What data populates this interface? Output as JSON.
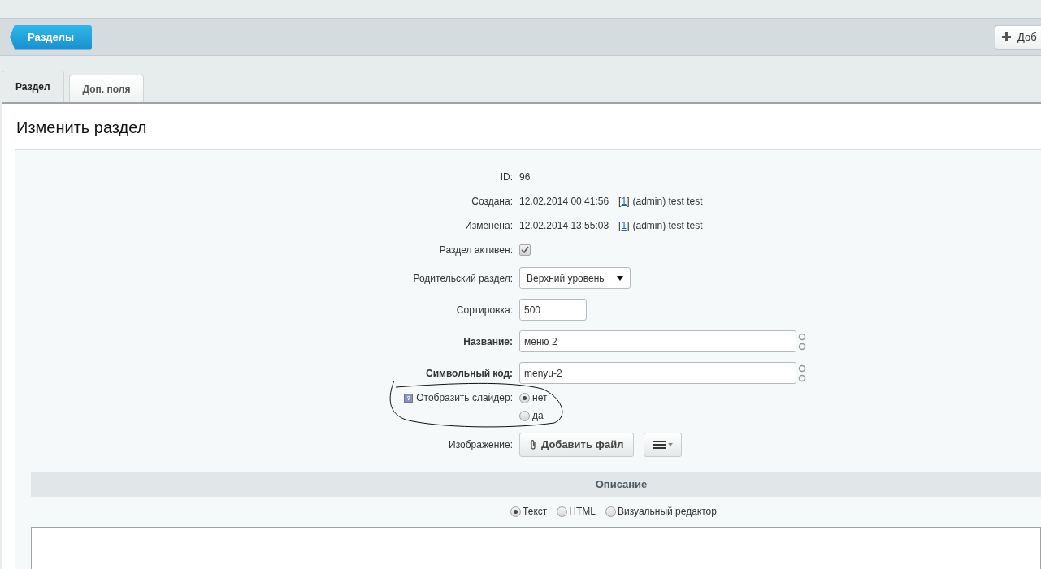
{
  "toolbar": {
    "back_button": "Разделы",
    "add_button": "Доб"
  },
  "tabs": [
    {
      "label": "Раздел",
      "selected": true
    },
    {
      "label": "Доп. поля",
      "selected": false
    }
  ],
  "heading": "Изменить раздел",
  "form": {
    "id": {
      "label": "ID:",
      "value": "96"
    },
    "created": {
      "label": "Создана:",
      "date": "12.02.2014 00:41:56",
      "bracket_left": "[",
      "user_link": "1",
      "bracket_right": "]",
      "user": "(admin) test test"
    },
    "modified": {
      "label": "Изменена:",
      "date": "12.02.2014 13:55:03",
      "bracket_left": "[",
      "user_link": "1",
      "bracket_right": "]",
      "user": "(admin) test test"
    },
    "active": {
      "label": "Раздел активен:",
      "checked": true
    },
    "parent": {
      "label": "Родительский раздел:",
      "value": "Верхний уровень"
    },
    "sort": {
      "label": "Сортировка:",
      "value": "500"
    },
    "name": {
      "label": "Название:",
      "value": "меню 2"
    },
    "code": {
      "label": "Символьный код:",
      "value": "menyu-2"
    },
    "slider": {
      "label": "Отобразить слайдер:",
      "help": "?",
      "options": [
        {
          "label": "нет",
          "selected": true
        },
        {
          "label": "да",
          "selected": false
        }
      ]
    },
    "image": {
      "label": "Изображение:",
      "button": "Добавить файл"
    }
  },
  "description": {
    "title": "Описание",
    "modes": [
      {
        "label": "Текст",
        "selected": true
      },
      {
        "label": "HTML",
        "selected": false
      },
      {
        "label": "Визуальный редактор",
        "selected": false
      }
    ]
  }
}
